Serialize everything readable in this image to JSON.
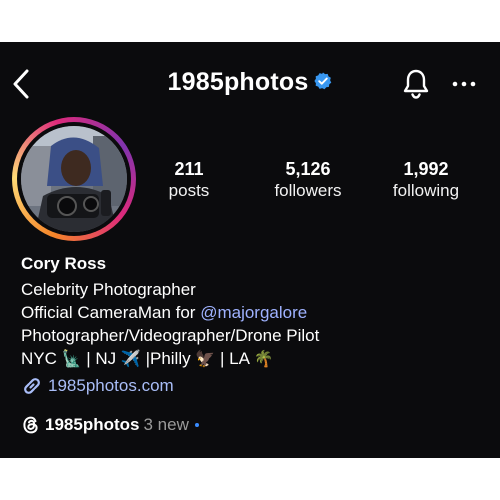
{
  "header": {
    "username": "1985photos",
    "verified": true
  },
  "stats": [
    {
      "value": "211",
      "label": "posts"
    },
    {
      "value": "5,126",
      "label": "followers"
    },
    {
      "value": "1,992",
      "label": "following"
    }
  ],
  "profile": {
    "name": "Cory Ross",
    "bio_line1": "Celebrity Photographer",
    "bio_line2_prefix": "Official CameraMan for ",
    "bio_mention": "@majorgalore",
    "bio_line3": "Photographer/Videographer/Drone Pilot",
    "bio_line4": {
      "nyc": "NYC ",
      "statue_emoji": "🗽",
      "nj": " | NJ ",
      "plane_emoji": "✈️",
      "philly": " |Philly ",
      "eagle_emoji": "🦅",
      "la": " | LA ",
      "palm_emoji": "🌴"
    },
    "website": "1985photos.com"
  },
  "threads": {
    "handle": "1985photos",
    "new_label": "3 new"
  },
  "colors": {
    "background": "#0b0b0d",
    "link": "#a9bdf7",
    "mention": "#9fb2ff",
    "verified": "#3897f0",
    "new_dot": "#3a8cff"
  },
  "icons": [
    "back-arrow-icon",
    "verified-badge-icon",
    "bell-icon",
    "more-options-icon",
    "link-icon",
    "threads-icon"
  ]
}
